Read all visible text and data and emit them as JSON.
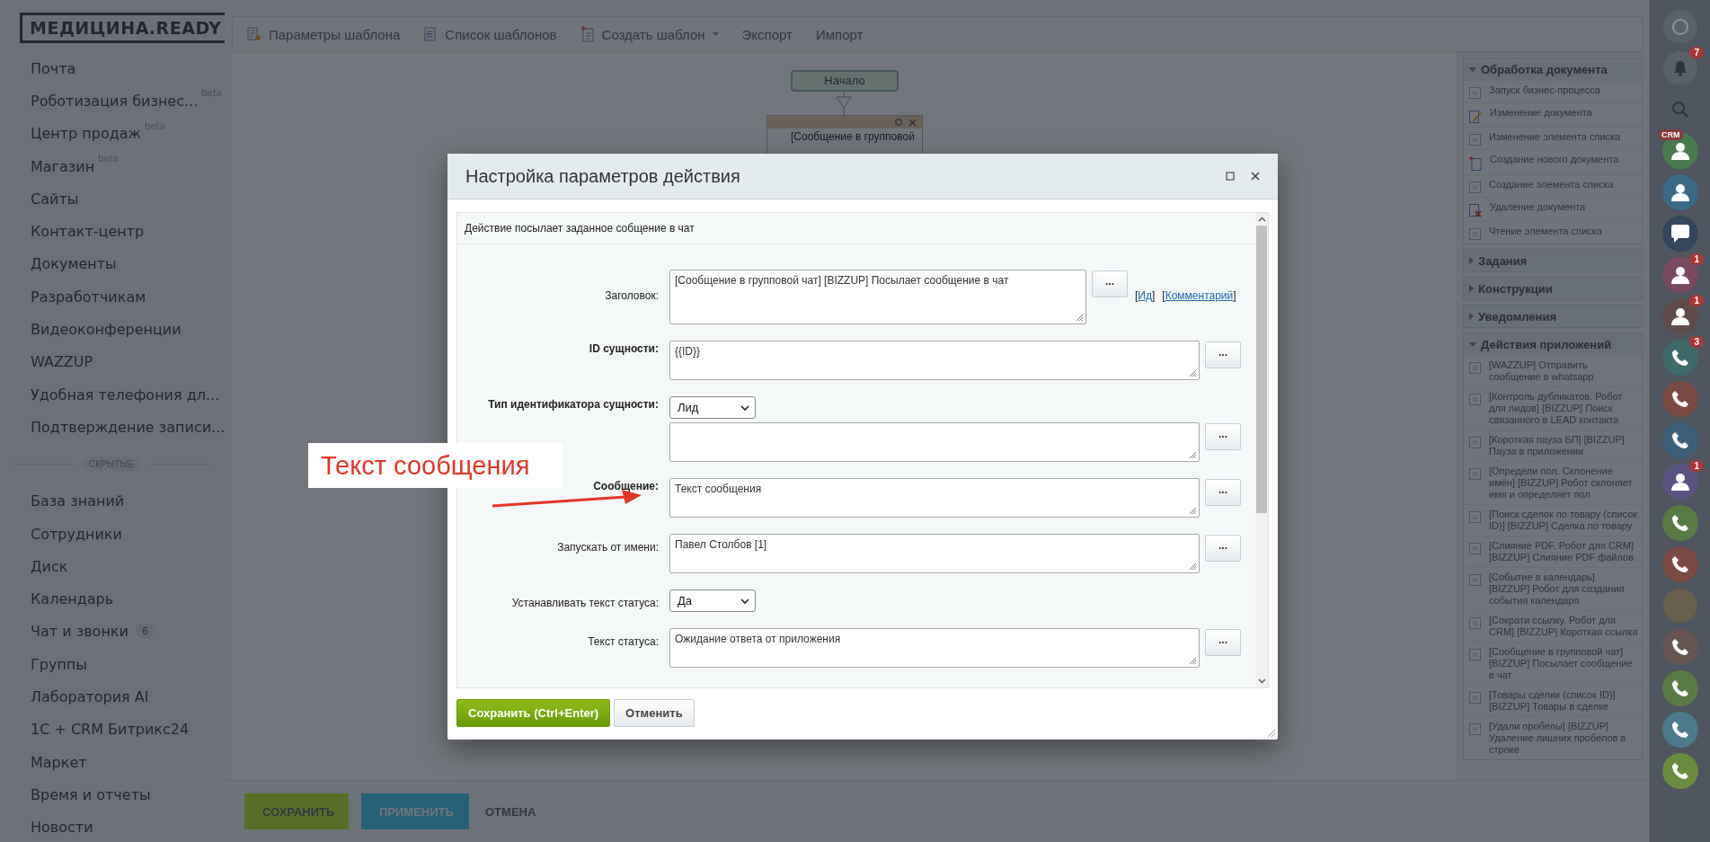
{
  "sidebar": {
    "logo": "МЕДИЦИНА.READY",
    "items": [
      {
        "label": "Почта"
      },
      {
        "label": "Роботизация бизнес...",
        "tag": "beta"
      },
      {
        "label": "Центр продаж",
        "tag": "beta"
      },
      {
        "label": "Магазин",
        "tag": "beta"
      },
      {
        "label": "Сайты"
      },
      {
        "label": "Контакт-центр"
      },
      {
        "label": "Документы"
      },
      {
        "label": "Разработчикам"
      },
      {
        "label": "Видеоконференции"
      },
      {
        "label": "WAZZUP"
      },
      {
        "label": "Удобная телефония дл..."
      },
      {
        "label": "Подтверждение записи..."
      }
    ],
    "divider": "СКРЫТЫЕ",
    "hidden_items": [
      {
        "label": "База знаний"
      },
      {
        "label": "Сотрудники"
      },
      {
        "label": "Диск"
      },
      {
        "label": "Календарь"
      },
      {
        "label": "Чат и звонки",
        "counter": "6"
      },
      {
        "label": "Группы"
      },
      {
        "label": "Лаборатория AI"
      },
      {
        "label": "1С + CRM Битрикс24"
      },
      {
        "label": "Маркет"
      },
      {
        "label": "Время и отчеты"
      },
      {
        "label": "Новости"
      }
    ]
  },
  "toolbar": {
    "items": [
      {
        "label": "Параметры шаблона",
        "kind": "settings"
      },
      {
        "label": "Список шаблонов",
        "kind": "list"
      },
      {
        "label": "Создать шаблон",
        "kind": "new",
        "dropdown": true
      },
      {
        "label": "Экспорт",
        "kind": "plain"
      },
      {
        "label": "Импорт",
        "kind": "plain"
      }
    ]
  },
  "canvas": {
    "start": "Начало",
    "block": "[Сообщение в групповой"
  },
  "palette": {
    "sections": [
      {
        "title": "Обработка документа",
        "expanded": true,
        "items": [
          {
            "label": "Запуск бизнес-процесса",
            "kind": "generic"
          },
          {
            "label": "Изменение документа",
            "kind": "edit"
          },
          {
            "label": "Изменение элемента списка",
            "kind": "generic"
          },
          {
            "label": "Создание нового документа",
            "kind": "new"
          },
          {
            "label": "Создание элемента списка",
            "kind": "generic"
          },
          {
            "label": "Удаление документа",
            "kind": "delete"
          },
          {
            "label": "Чтение элемента списка",
            "kind": "generic"
          }
        ]
      },
      {
        "title": "Задания",
        "expanded": false
      },
      {
        "title": "Конструкции",
        "expanded": false
      },
      {
        "title": "Уведомления",
        "expanded": false
      },
      {
        "title": "Действия приложений",
        "expanded": true,
        "items": [
          {
            "label": "[WAZZUP] Отправить сообщение в whatsapp",
            "kind": "generic"
          },
          {
            "label": "[Контроль дубликатов. Робот для лидов] [BIZZUP] Поиск связанного в LEAD контакта",
            "kind": "generic"
          },
          {
            "label": "[Короткая пауза БП] [BIZZUP] Пауза в приложении",
            "kind": "generic"
          },
          {
            "label": "[Определи пол. Склонение имён] [BIZZUP] Робот склоняет имя и определяет пол",
            "kind": "generic"
          },
          {
            "label": "[Поиск сделок по товару (список ID)] [BIZZUP] Сделка по товару",
            "kind": "generic"
          },
          {
            "label": "[Слияние PDF. Робот для CRM] [BIZZUP] Слияние PDF файлов",
            "kind": "generic"
          },
          {
            "label": "[Событие в календарь] [BIZZUP] Робот для создания события календаря",
            "kind": "generic"
          },
          {
            "label": "[Сократи ссылку. Робот для CRM] [BIZZUP] Короткая ссылка",
            "kind": "generic"
          },
          {
            "label": "[Сообщение в групповой чат] [BIZZUP] Посылает сообщение в чат",
            "kind": "generic"
          },
          {
            "label": "[Товары сделки (список ID)] [BIZZUP] Товары в сделке",
            "kind": "generic"
          },
          {
            "label": "[Удали пробелы] [BIZZUP] Удаление лишних пробелов в строке",
            "kind": "generic"
          }
        ]
      }
    ]
  },
  "bottom_bar": {
    "buttons": [
      {
        "label": "СОХРАНИТЬ",
        "kind": "save"
      },
      {
        "label": "ПРИМЕНИТЬ",
        "kind": "apply"
      },
      {
        "label": "ОТМЕНА",
        "kind": "cancel"
      }
    ]
  },
  "rail": [
    {
      "kind": "help"
    },
    {
      "kind": "bell",
      "badge": "7"
    },
    {
      "kind": "search"
    },
    {
      "kind": "crm",
      "color": "#4a7a4f",
      "tag": "CRM"
    },
    {
      "kind": "person-clock",
      "color": "#3a6a85"
    },
    {
      "kind": "chat",
      "color": "#34465c"
    },
    {
      "kind": "person",
      "color": "#7a4a60",
      "badge": "1"
    },
    {
      "kind": "person",
      "color": "#5f4c4a",
      "badge": "1"
    },
    {
      "kind": "phone",
      "color": "#3f6a6a",
      "badge": "3"
    },
    {
      "kind": "phone",
      "color": "#7a4a45"
    },
    {
      "kind": "phone",
      "color": "#3d5f7a"
    },
    {
      "kind": "person",
      "color": "#5a5480",
      "badge": "1"
    },
    {
      "kind": "phone",
      "color": "#5a7a45"
    },
    {
      "kind": "phone",
      "color": "#7a4a45"
    },
    {
      "kind": "photo"
    },
    {
      "kind": "phone",
      "color": "#665552"
    },
    {
      "kind": "phone",
      "color": "#5a7a45"
    },
    {
      "kind": "cloud-phone",
      "color": "#4d7a8a"
    },
    {
      "kind": "handset",
      "color": "#6a8a40"
    }
  ],
  "dialog": {
    "title": "Настройка параметров действия",
    "description": "Действие посылает заданное собщение в чат",
    "fields": [
      {
        "label": "Заголовок:",
        "required": false,
        "controls": [
          {
            "kind": "textarea",
            "value": "[Сообщение в групповой чат] [BIZZUP] Посылает сообщение в чат",
            "button": "...",
            "links": [
              {
                "pre": "[",
                "text": "Ид",
                "post": "]"
              },
              {
                "pre": "[",
                "text": "Комментарий",
                "post": "]"
              }
            ]
          }
        ]
      },
      {
        "label": "ID сущности:",
        "required": true,
        "controls": [
          {
            "kind": "textarea",
            "value": "{{ID}}",
            "button": "..."
          }
        ]
      },
      {
        "label": "Тип идентификатора сущности:",
        "required": true,
        "controls": [
          {
            "kind": "select",
            "value": "Лид"
          },
          {
            "kind": "textarea",
            "button": "..."
          }
        ]
      },
      {
        "label": "Сообщение:",
        "required": true,
        "controls": [
          {
            "kind": "textarea",
            "value": "Текст сообщения",
            "button": "..."
          }
        ]
      },
      {
        "label": "Запускать от имени:",
        "required": false,
        "controls": [
          {
            "kind": "textarea",
            "value": "Павел Столбов [1]",
            "button": "..."
          }
        ]
      },
      {
        "label": "Устанавливать текст статуса:",
        "required": false,
        "controls": [
          {
            "kind": "select",
            "value": "Да"
          }
        ]
      },
      {
        "label": "Текст статуса:",
        "required": false,
        "controls": [
          {
            "kind": "textarea",
            "value": "Ожидание ответа от приложения",
            "button": "..."
          }
        ]
      }
    ],
    "buttons": [
      {
        "label": "Сохранить (Ctrl+Enter)",
        "kind": "primary"
      },
      {
        "label": "Отменить",
        "kind": "secondary"
      }
    ]
  },
  "annotation": {
    "text": "Текст сообщения"
  }
}
